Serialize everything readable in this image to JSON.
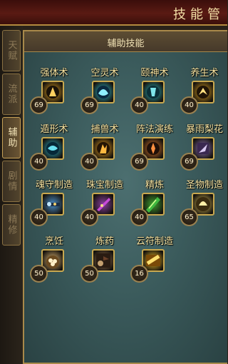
{
  "header": {
    "title": "技能管"
  },
  "side_tabs": [
    {
      "label": "天赋",
      "active": false
    },
    {
      "label": "流派",
      "active": false
    },
    {
      "label": "辅助",
      "active": true
    },
    {
      "label": "剧情",
      "active": false
    },
    {
      "label": "精修",
      "active": false
    }
  ],
  "panel": {
    "title": "辅助技能"
  },
  "skills": [
    {
      "name": "强体术",
      "level": "69",
      "icon": "strength-icon",
      "color": "#e2a020"
    },
    {
      "name": "空灵术",
      "level": "69",
      "icon": "spirit-icon",
      "color": "#2fb6c8"
    },
    {
      "name": "颐神术",
      "level": "40",
      "icon": "mind-icon",
      "color": "#2bb0b8"
    },
    {
      "name": "养生术",
      "level": "40",
      "icon": "health-icon",
      "color": "#e0a220"
    },
    {
      "name": "遁形术",
      "level": "40",
      "icon": "stealth-icon",
      "color": "#2aa8c0"
    },
    {
      "name": "捕兽术",
      "level": "40",
      "icon": "taming-icon",
      "color": "#e49a1e"
    },
    {
      "name": "阵法演练",
      "level": "69",
      "icon": "formation-icon",
      "color": "#d8742a"
    },
    {
      "name": "暴雨梨花",
      "level": "69",
      "icon": "dart-icon",
      "color": "#8a6fb0"
    },
    {
      "name": "魂守制造",
      "level": "40",
      "icon": "soul-craft-icon",
      "color": "#4a8ec8"
    },
    {
      "name": "珠宝制造",
      "level": "40",
      "icon": "jewel-craft-icon",
      "color": "#8a3ea0"
    },
    {
      "name": "精炼",
      "level": "40",
      "icon": "refine-icon",
      "color": "#3fa030"
    },
    {
      "name": "圣物制造",
      "level": "65",
      "icon": "relic-craft-icon",
      "color": "#e0c058"
    },
    {
      "name": "烹饪",
      "level": "50",
      "icon": "cooking-icon",
      "color": "#d8b070"
    },
    {
      "name": "炼药",
      "level": "50",
      "icon": "alchemy-icon",
      "color": "#9a7250"
    },
    {
      "name": "云符制造",
      "level": "16",
      "icon": "talisman-icon",
      "color": "#e8b828"
    }
  ]
}
